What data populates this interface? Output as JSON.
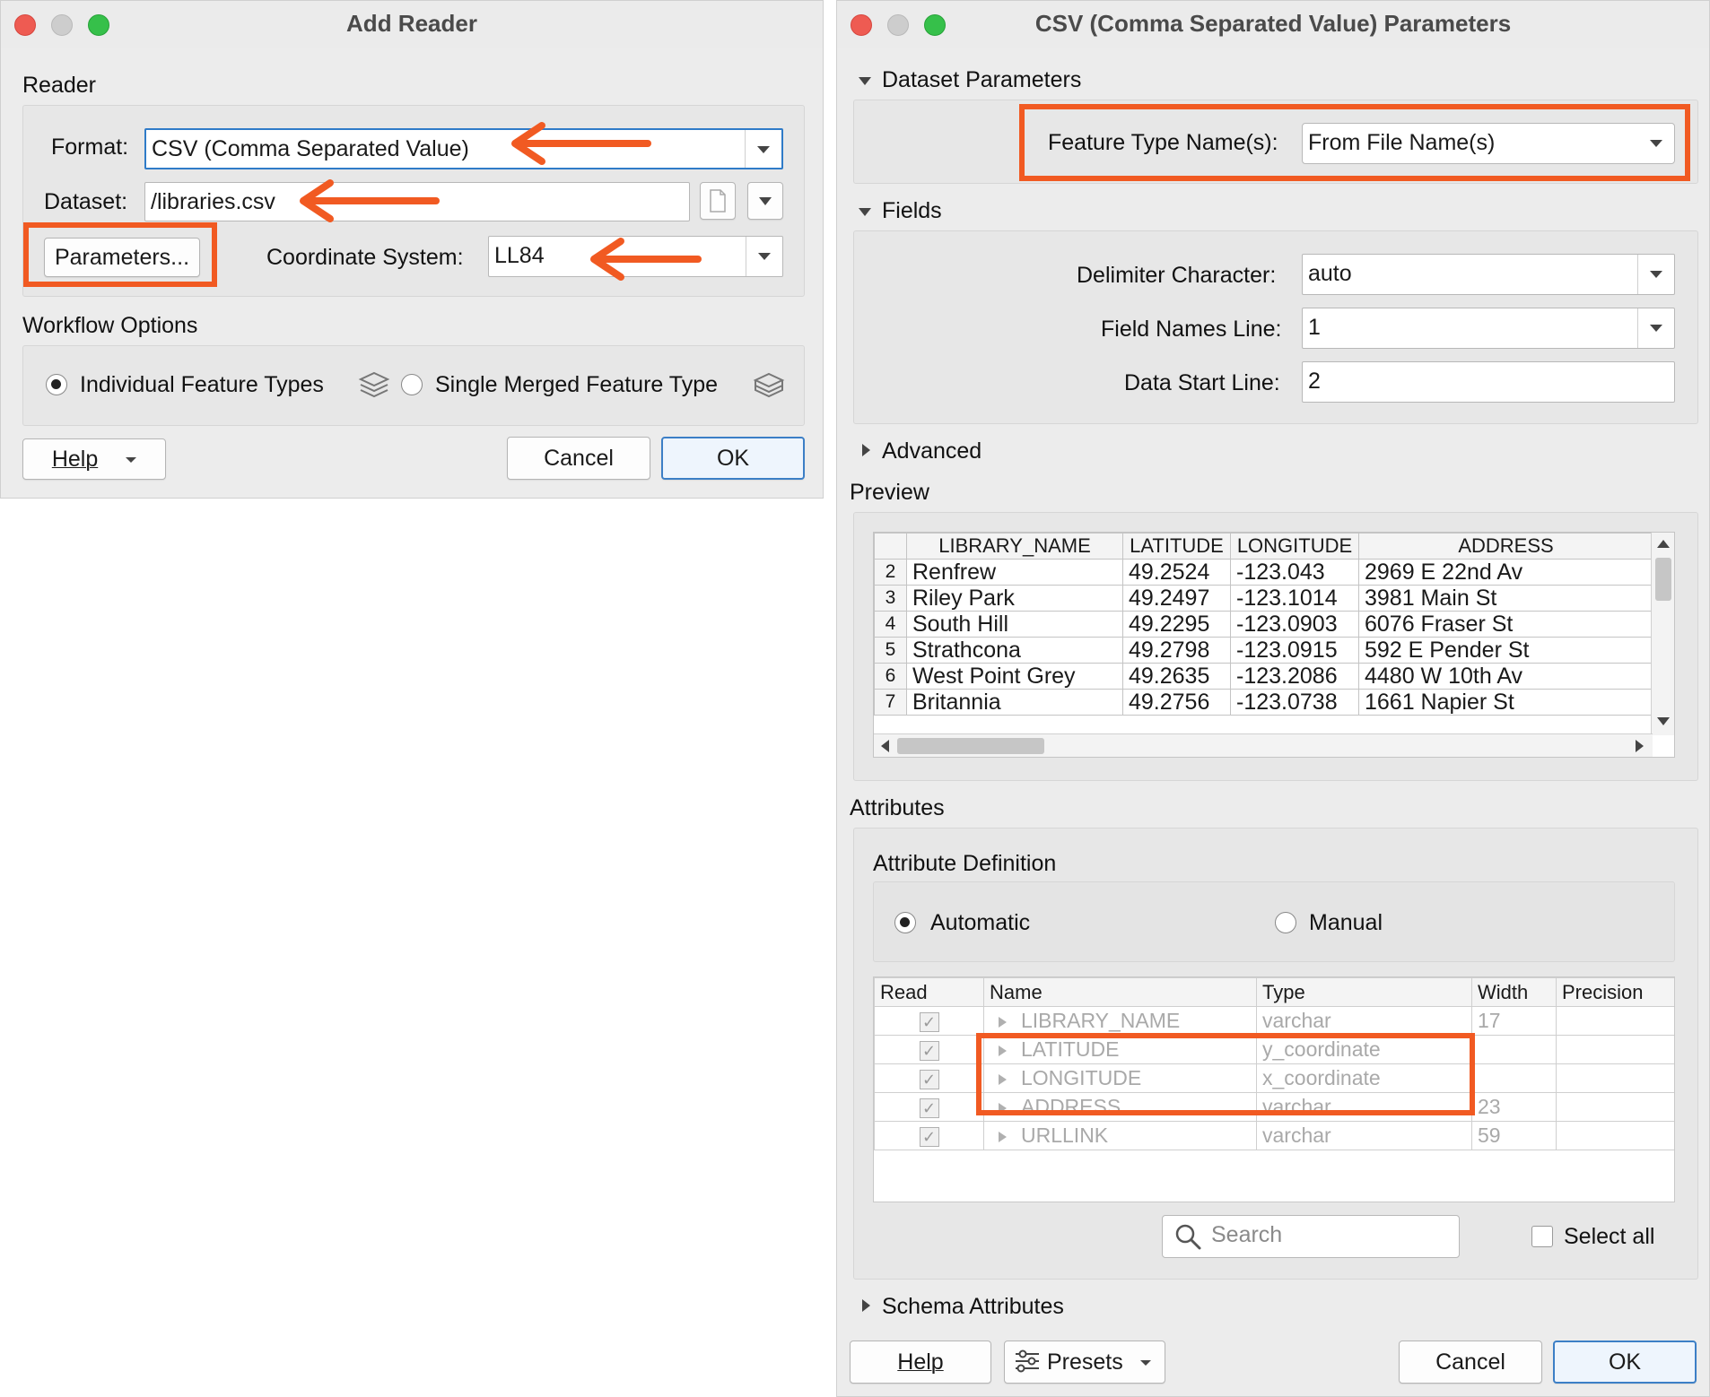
{
  "add_reader": {
    "title": "Add Reader",
    "reader_section": "Reader",
    "format_label": "Format:",
    "format_value": "CSV (Comma Separated Value)",
    "dataset_label": "Dataset:",
    "dataset_value": "/libraries.csv",
    "parameters_button": "Parameters...",
    "coord_label": "Coordinate System:",
    "coord_value": "LL84",
    "workflow_section": "Workflow Options",
    "option_individual": "Individual Feature Types",
    "option_merged": "Single Merged Feature Type",
    "help_button": "Help",
    "cancel_button": "Cancel",
    "ok_button": "OK"
  },
  "csv_params": {
    "title": "CSV (Comma Separated Value) Parameters",
    "dataset_parameters_section": "Dataset Parameters",
    "feature_type_label": "Feature Type Name(s):",
    "feature_type_value": "From File Name(s)",
    "fields_section": "Fields",
    "delimiter_label": "Delimiter Character:",
    "delimiter_value": "auto",
    "field_names_line_label": "Field Names Line:",
    "field_names_line_value": "1",
    "data_start_line_label": "Data Start Line:",
    "data_start_line_value": "2",
    "advanced_section": "Advanced",
    "preview_section": "Preview",
    "preview": {
      "columns": [
        "LIBRARY_NAME",
        "LATITUDE",
        "LONGITUDE",
        "ADDRESS"
      ],
      "rows": [
        {
          "n": "2",
          "cells": [
            "Renfrew",
            "49.2524",
            "-123.043",
            "2969 E 22nd Av"
          ]
        },
        {
          "n": "3",
          "cells": [
            "Riley Park",
            "49.2497",
            "-123.1014",
            "3981 Main St"
          ]
        },
        {
          "n": "4",
          "cells": [
            "South Hill",
            "49.2295",
            "-123.0903",
            "6076 Fraser St"
          ]
        },
        {
          "n": "5",
          "cells": [
            "Strathcona",
            "49.2798",
            "-123.0915",
            "592 E Pender St"
          ]
        },
        {
          "n": "6",
          "cells": [
            "West Point Grey",
            "49.2635",
            "-123.2086",
            "4480 W 10th Av"
          ]
        },
        {
          "n": "7",
          "cells": [
            "Britannia",
            "49.2756",
            "-123.0738",
            "1661 Napier St"
          ]
        }
      ]
    },
    "attributes_section": "Attributes",
    "attribute_definition_label": "Attribute Definition",
    "mode_automatic": "Automatic",
    "mode_manual": "Manual",
    "attr_table": {
      "columns": [
        "Read",
        "Name",
        "Type",
        "Width",
        "Precision"
      ],
      "rows": [
        {
          "read": true,
          "name": "LIBRARY_NAME",
          "type": "varchar",
          "width": "17",
          "precision": ""
        },
        {
          "read": true,
          "name": "LATITUDE",
          "type": "y_coordinate",
          "width": "",
          "precision": ""
        },
        {
          "read": true,
          "name": "LONGITUDE",
          "type": "x_coordinate",
          "width": "",
          "precision": ""
        },
        {
          "read": true,
          "name": "ADDRESS",
          "type": "varchar",
          "width": "23",
          "precision": ""
        },
        {
          "read": true,
          "name": "URLLINK",
          "type": "varchar",
          "width": "59",
          "precision": ""
        }
      ]
    },
    "search_placeholder": "Search",
    "select_all_label": "Select all",
    "schema_attributes_section": "Schema Attributes",
    "help_button": "Help",
    "presets_button": "Presets",
    "cancel_button": "Cancel",
    "ok_button": "OK"
  },
  "colors": {
    "highlight": "#f15a22",
    "default_button": "#3c7fc6",
    "window_bg": "#ececec"
  },
  "icons": [
    "feature-types-stack-icon",
    "merged-stack-icon",
    "file-browse-icon",
    "search-icon",
    "presets-sliders-icon",
    "arrow-annotation"
  ]
}
